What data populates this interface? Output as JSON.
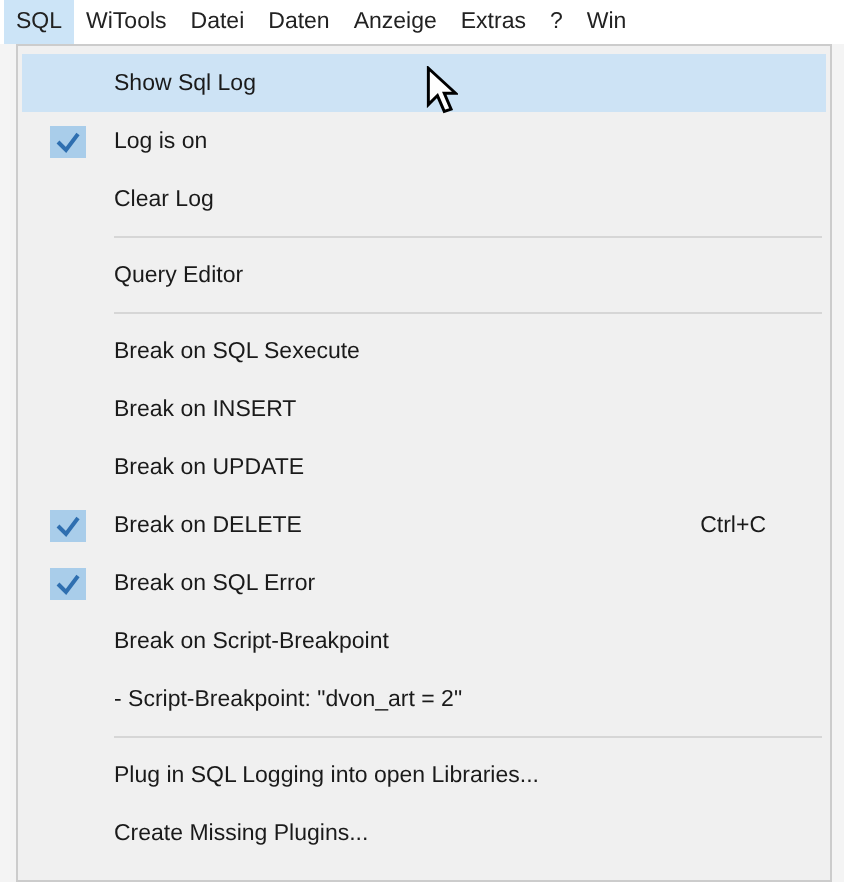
{
  "menubar": [
    {
      "label": "SQL",
      "selected": true
    },
    {
      "label": "WiTools",
      "selected": false
    },
    {
      "label": "Datei",
      "selected": false
    },
    {
      "label": "Daten",
      "selected": false
    },
    {
      "label": "Anzeige",
      "selected": false
    },
    {
      "label": "Extras",
      "selected": false
    },
    {
      "label": "?",
      "selected": false
    },
    {
      "label": "Win",
      "selected": false
    }
  ],
  "menu": [
    {
      "kind": "item",
      "label": "Show Sql Log",
      "checked": false,
      "selected": true
    },
    {
      "kind": "item",
      "label": "Log is on",
      "checked": true,
      "selected": false
    },
    {
      "kind": "item",
      "label": "Clear Log",
      "checked": false,
      "selected": false
    },
    {
      "kind": "separator"
    },
    {
      "kind": "item",
      "label": "Query Editor",
      "checked": false,
      "selected": false
    },
    {
      "kind": "separator"
    },
    {
      "kind": "item",
      "label": "Break on SQL Sexecute",
      "checked": false,
      "selected": false
    },
    {
      "kind": "item",
      "label": "Break on INSERT",
      "checked": false,
      "selected": false
    },
    {
      "kind": "item",
      "label": "Break on UPDATE",
      "checked": false,
      "selected": false
    },
    {
      "kind": "item",
      "label": "Break on DELETE",
      "checked": true,
      "selected": false,
      "shortcut": "Ctrl+C"
    },
    {
      "kind": "item",
      "label": "Break on SQL Error",
      "checked": true,
      "selected": false
    },
    {
      "kind": "item",
      "label": "Break on Script-Breakpoint",
      "checked": false,
      "selected": false
    },
    {
      "kind": "item",
      "label": "- Script-Breakpoint: \"dvon_art = 2\"",
      "checked": false,
      "selected": false
    },
    {
      "kind": "separator"
    },
    {
      "kind": "item",
      "label": "Plug in SQL Logging into open Libraries...",
      "checked": false,
      "selected": false
    },
    {
      "kind": "item",
      "label": "Create Missing Plugins...",
      "checked": false,
      "selected": false
    }
  ]
}
